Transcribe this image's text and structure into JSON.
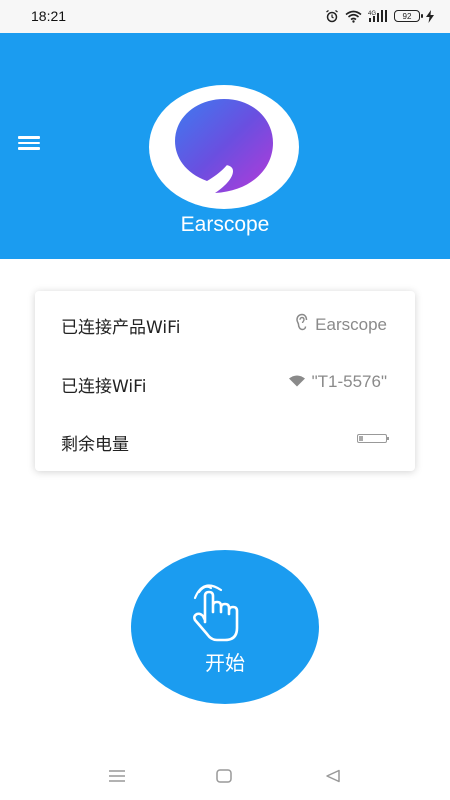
{
  "status_bar": {
    "time": "18:21",
    "battery_level": "92",
    "icons": [
      "alarm-icon",
      "wifi-icon",
      "cellular-4g-icon",
      "battery-icon",
      "charging-icon"
    ]
  },
  "header": {
    "menu_icon": "hamburger-menu-icon",
    "logo_icon": "earscope-logo-icon",
    "app_title": "Earscope",
    "background_color": "#1b9cf0"
  },
  "info_card": {
    "rows": [
      {
        "label": "已连接产品WiFi",
        "value": "Earscope",
        "icon": "ear-icon"
      },
      {
        "label": "已连接WiFi",
        "value": "\"T1-5576\"",
        "icon": "wifi-icon"
      },
      {
        "label": "剩余电量",
        "value": "",
        "icon": "battery-icon",
        "battery_fraction": 0.15
      }
    ]
  },
  "start_button": {
    "label": "开始",
    "icon": "hand-tap-icon",
    "color": "#1b9cf0"
  },
  "nav_bar": {
    "items": [
      "menu-nav-icon",
      "home-nav-icon",
      "back-nav-icon"
    ]
  }
}
